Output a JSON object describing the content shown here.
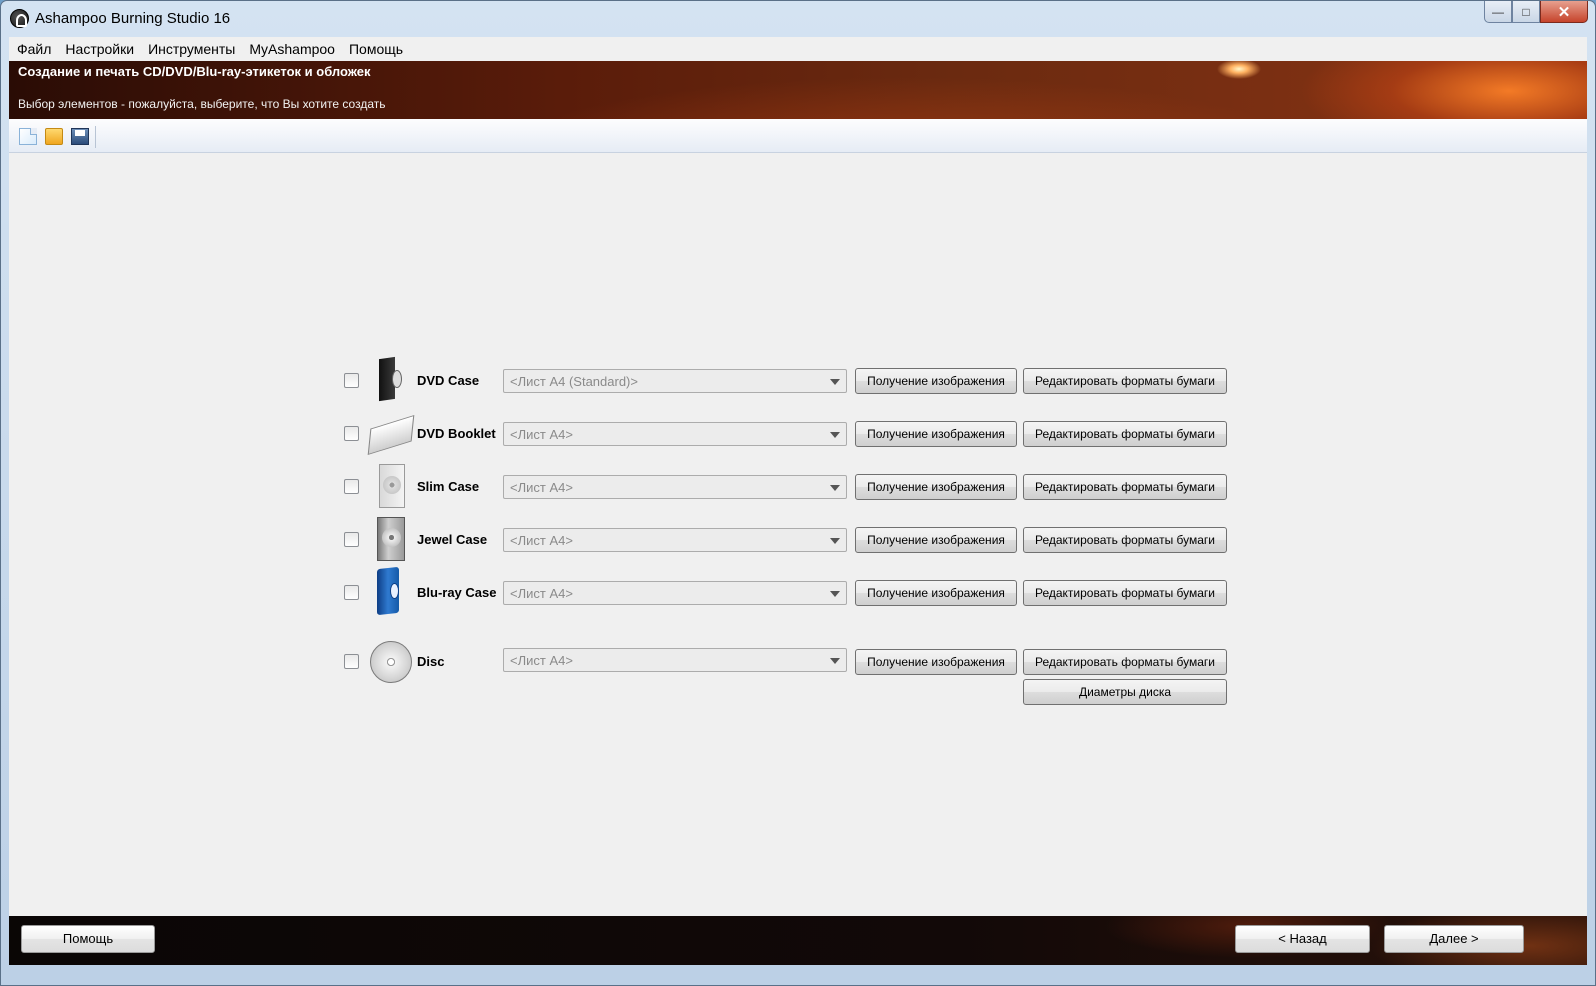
{
  "window": {
    "title": "Ashampoo Burning Studio 16",
    "controls": {
      "minimize": "—",
      "maximize": "□",
      "close": "✕"
    }
  },
  "menu": [
    "Файл",
    "Настройки",
    "Инструменты",
    "MyAshampoo",
    "Помощь"
  ],
  "banner": {
    "title": "Создание и печать CD/DVD/Blu-ray-этикеток и обложек",
    "subtitle": "Выбор элементов - пожалуйста, выберите, что Вы хотите создать"
  },
  "toolbar": {
    "icons": [
      "new-document-icon",
      "open-folder-icon",
      "save-disk-icon"
    ]
  },
  "items": [
    {
      "icon": "dvd-case-icon",
      "label": "DVD Case",
      "paper": "<Лист А4 (Standard)>",
      "checked": false
    },
    {
      "icon": "dvd-booklet-icon",
      "label": "DVD Booklet",
      "paper": "<Лист А4>",
      "checked": false
    },
    {
      "icon": "slim-case-icon",
      "label": "Slim Case",
      "paper": "<Лист А4>",
      "checked": false
    },
    {
      "icon": "jewel-case-icon",
      "label": "Jewel Case",
      "paper": "<Лист А4>",
      "checked": false
    },
    {
      "icon": "bluray-case-icon",
      "label": "Blu-ray Case",
      "paper": "<Лист А4>",
      "checked": false
    },
    {
      "icon": "disc-icon",
      "label": "Disc",
      "paper": "<Лист А4>",
      "checked": false
    }
  ],
  "buttons": {
    "get_image": "Получение изображения",
    "edit_formats": "Редактировать форматы бумаги",
    "disc_diameters": "Диаметры диска"
  },
  "footer": {
    "help": "Помощь",
    "back": "< Назад",
    "next": "Далее >"
  }
}
